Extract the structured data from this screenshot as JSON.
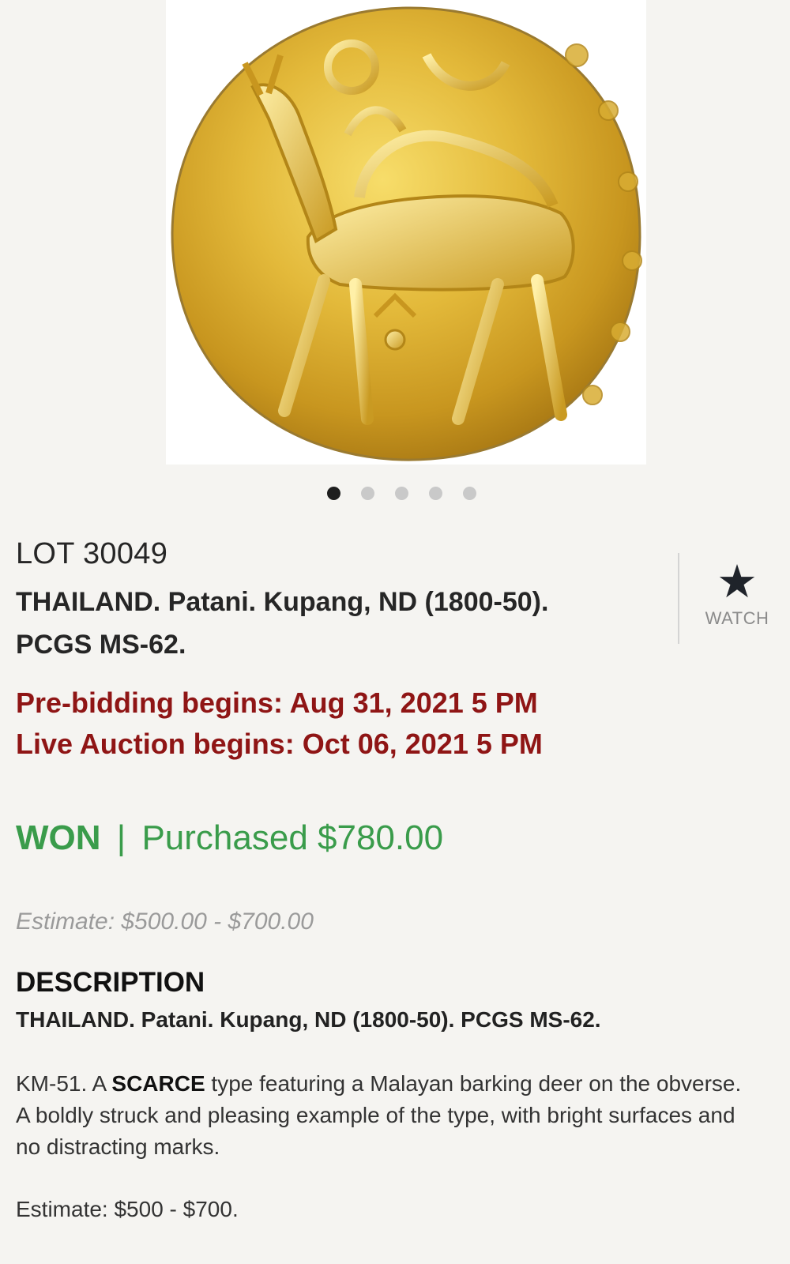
{
  "gallery": {
    "image_alt": "Gold coin showing a barking deer",
    "image_count": 5,
    "active_index": 0
  },
  "lot": {
    "number": "LOT 30049",
    "title_line1": "THAILAND. Patani. Kupang, ND (1800-50).",
    "title_line2": "PCGS MS-62."
  },
  "watch": {
    "icon": "star-icon",
    "label": "WATCH"
  },
  "dates": {
    "prebidding": "Pre-bidding begins: Aug 31, 2021 5 PM",
    "live": "Live Auction begins: Oct 06, 2021 5 PM"
  },
  "result": {
    "status": "WON",
    "separator": "|",
    "purchased": "Purchased $780.00"
  },
  "estimate_summary": "Estimate: $500.00 - $700.00",
  "description": {
    "heading": "DESCRIPTION",
    "title": "THAILAND. Patani. Kupang, ND (1800-50). PCGS MS-62.",
    "body_prefix": "KM-51. A ",
    "body_bold": "SCARCE",
    "body_line1_rest": " type featuring a Malayan barking deer on the obverse.",
    "body_line2": "A boldly struck and pleasing example of the type, with bright surfaces and",
    "body_line3": "no distracting marks.",
    "estimate": "Estimate: $500 - $700."
  },
  "colors": {
    "background": "#f5f4f1",
    "date_red": "#8f1515",
    "won_green": "#3a9c4b",
    "muted_gray": "#9a9a9a",
    "dot_active": "#1e1e1e",
    "dot_inactive": "#c9c9c9"
  }
}
